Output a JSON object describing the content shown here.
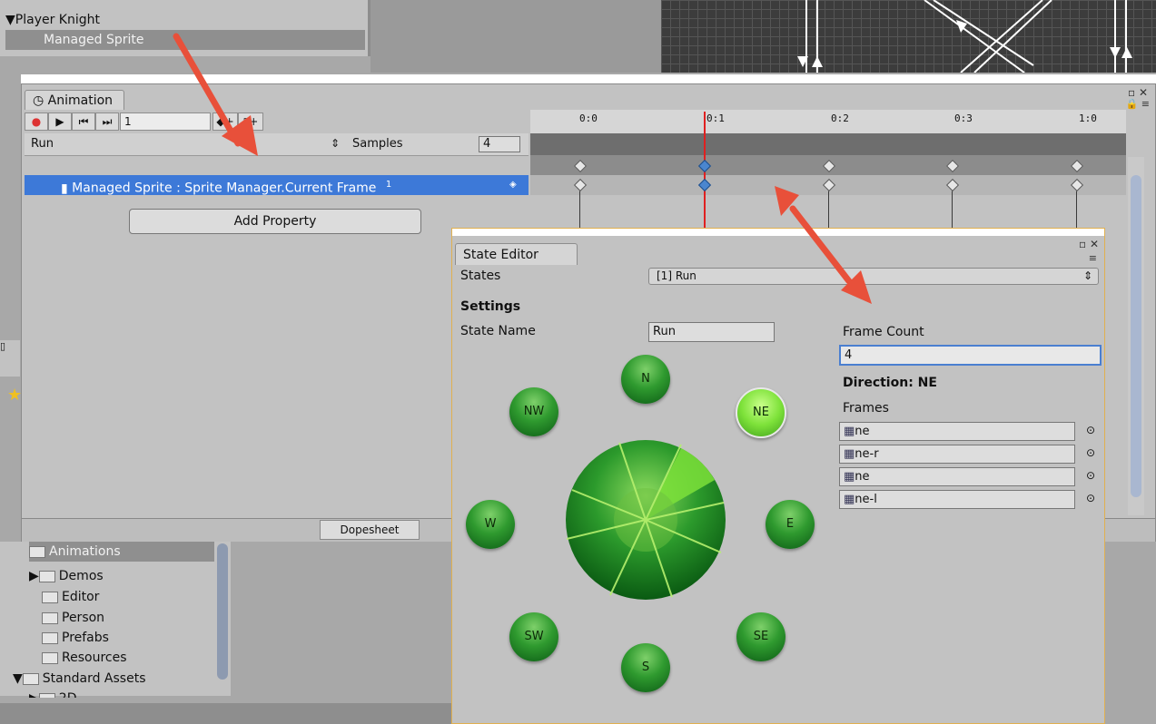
{
  "hierarchy": {
    "items": [
      {
        "label": "Player Knight",
        "indent": 0,
        "expanded": true
      },
      {
        "label": "Managed Sprite",
        "indent": 1,
        "selected": true
      }
    ]
  },
  "animation": {
    "tab_label": "Animation",
    "frame_value": "1",
    "clip_name": "Run",
    "samples_label": "Samples",
    "samples_value": "4",
    "property_label": "Managed Sprite : Sprite Manager.Current Frame",
    "property_value": "1",
    "add_property_label": "Add Property",
    "dopesheet_label": "Dopesheet",
    "timeline_ticks": [
      "0:0",
      "0:1",
      "0:2",
      "0:3",
      "1:0"
    ]
  },
  "state_editor": {
    "tab_label": "State Editor",
    "states_label": "States",
    "states_value": "[1] Run",
    "settings_heading": "Settings",
    "state_name_label": "State Name",
    "state_name_value": "Run",
    "frame_count_label": "Frame Count",
    "frame_count_value": "4",
    "direction_label": "Direction: NE",
    "frames_label": "Frames",
    "frames": [
      "ne",
      "ne-r",
      "ne",
      "ne-l"
    ],
    "directions": [
      "N",
      "NE",
      "E",
      "SE",
      "S",
      "SW",
      "W",
      "NW"
    ],
    "active_direction": "NE"
  },
  "project": {
    "items": [
      {
        "label": "Animations",
        "selected": true
      },
      {
        "label": "Demos",
        "arrow": true
      },
      {
        "label": "Editor"
      },
      {
        "label": "Person"
      },
      {
        "label": "Prefabs"
      },
      {
        "label": "Resources"
      },
      {
        "label": "Standard Assets",
        "expanded": true
      },
      {
        "label": "2D",
        "arrow": true
      }
    ]
  },
  "colors": {
    "accent_arrow": "#e8503a",
    "selection_blue": "#3d79d8",
    "playhead_red": "#e02020"
  }
}
